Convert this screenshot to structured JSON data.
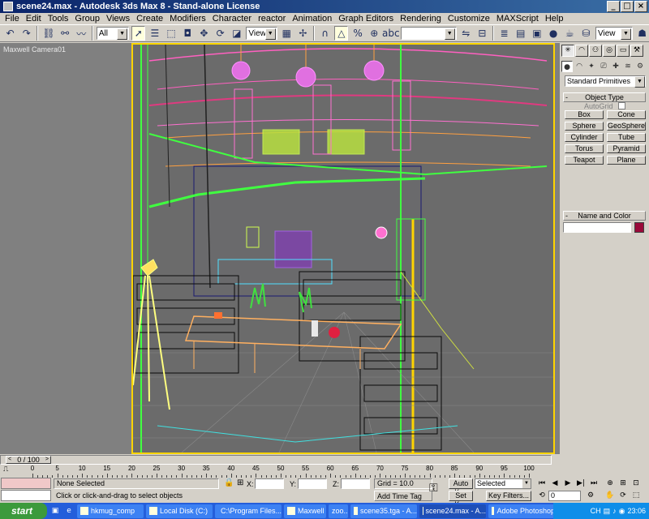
{
  "window": {
    "title": "scene24.max - Autodesk 3ds Max 8  - Stand-alone License",
    "btn_min": "_",
    "btn_max": "□",
    "btn_close": "×"
  },
  "menu": [
    "File",
    "Edit",
    "Tools",
    "Group",
    "Views",
    "Create",
    "Modifiers",
    "Character",
    "reactor",
    "Animation",
    "Graph Editors",
    "Rendering",
    "Customize",
    "MAXScript",
    "Help"
  ],
  "toolbar": {
    "selection_filter": "All",
    "ref_coord": "View",
    "named_selection": "",
    "render_view": "View"
  },
  "viewport": {
    "label": "Maxwell Camera01"
  },
  "command_panel": {
    "category": "Standard Primitives",
    "object_type_title": "Object Type",
    "autogrid_label": "AutoGrid",
    "primitives": [
      "Box",
      "Cone",
      "Sphere",
      "GeoSphere",
      "Cylinder",
      "Tube",
      "Torus",
      "Pyramid",
      "Teapot",
      "Plane"
    ],
    "name_color_title": "Name and Color",
    "minus": "-"
  },
  "timeline": {
    "frame_display": "0 / 100",
    "ticks": [
      "0",
      "5",
      "10",
      "15",
      "20",
      "25",
      "30",
      "35",
      "40",
      "45",
      "50",
      "55",
      "60",
      "65",
      "70",
      "75",
      "80",
      "85",
      "90",
      "95",
      "100"
    ]
  },
  "status": {
    "selection_text": "None Selected",
    "prompt_text": "Click or click-and-drag to select objects",
    "x_label": "X:",
    "y_label": "Y:",
    "z_label": "Z:",
    "grid_text": "Grid = 10.0",
    "add_time_tag": "Add Time Tag",
    "auto_key": "Auto Key",
    "set_key": "Set Key",
    "key_mode_value": "Selected",
    "key_filters": "Key Filters...",
    "current_frame": "0"
  },
  "taskbar": {
    "start": "start",
    "tasks": [
      "hkmug_comp",
      "Local Disk (C:)",
      "C:\\Program Files...",
      "Maxwell",
      "zoo...",
      "scene35.tga - A...",
      "scene24.max - A...",
      "Adobe Photoshop"
    ],
    "tray_lang": "CH",
    "clock": "23:06"
  },
  "colors": {
    "viewport_border": "#ffd400",
    "title_gradient_start": "#0a246a",
    "taskbar": "#245edb",
    "start_button": "#3c9a3c",
    "object_color": "#9a0a3a"
  }
}
